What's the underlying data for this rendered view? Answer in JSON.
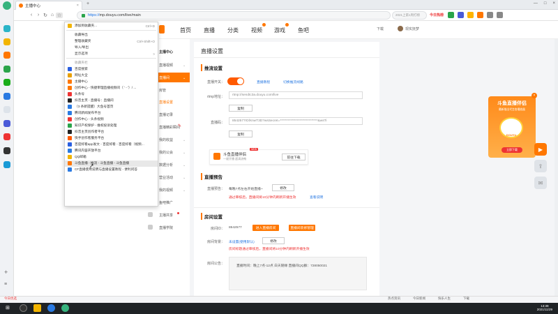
{
  "browser": {
    "tab_title": "主播中心",
    "tab_close": "×",
    "new_tab": "+",
    "url_scheme": "https://",
    "url": "mp.douyu.com/live/main",
    "search_placeholder": "2021上第1周打榜",
    "hot_label": "今日热榜",
    "window_controls": [
      "—",
      "□",
      "×"
    ]
  },
  "bookmark_menu": {
    "items": [
      {
        "label": "添加到收藏夹...",
        "shortcut": "Ctrl+D",
        "icon_color": "#f2b400"
      },
      {
        "label": "收藏导出",
        "shortcut": "",
        "icon_color": ""
      },
      {
        "label": "整理收藏夹",
        "shortcut": "Ctrl+Shift+O",
        "icon_color": ""
      },
      {
        "label": "导入/导出",
        "shortcut": "",
        "icon_color": ""
      },
      {
        "label": "显示选项",
        "shortcut": ">",
        "icon_color": ""
      },
      {
        "label": "收藏夹栏",
        "shortcut": "",
        "icon_color": "",
        "head": true
      },
      {
        "label": "百度搜索",
        "shortcut": "",
        "icon_color": "#2a5fe0"
      },
      {
        "label": "网址大全",
        "shortcut": "",
        "icon_color": "#e9a000"
      },
      {
        "label": "主播中心",
        "shortcut": "",
        "icon_color": "#ff7700"
      },
      {
        "label": "创作中心 - 快捷审理直播视频间（ ' - '）/ ...",
        "shortcut": "",
        "icon_color": "#ff7700"
      },
      {
        "label": "头条号",
        "shortcut": "",
        "icon_color": "#e33"
      },
      {
        "label": "抖音主页 - 直播号：直播间",
        "shortcut": "",
        "icon_color": "#222"
      },
      {
        "label": "（3 条新提醒）大鱼号首页",
        "shortcut": "",
        "icon_color": "#2a7ae2"
      },
      {
        "label": "腾讯新闻发布平台",
        "shortcut": "",
        "icon_color": "#2a7ae2"
      },
      {
        "label": "创作中心 - 头条视频",
        "shortcut": "",
        "icon_color": "#e33"
      },
      {
        "label": "知识产权保护 - 维权投诉处理",
        "shortcut": "",
        "icon_color": "#2aa44a"
      },
      {
        "label": "抖音主页创作者平台",
        "shortcut": "",
        "icon_color": "#222"
      },
      {
        "label": "快手创作者服务平台",
        "shortcut": "",
        "icon_color": "#ff5a00"
      },
      {
        "label": "百度好看app发文 - 百度好看 - 百度好看（视频...",
        "shortcut": "",
        "icon_color": "#2a5fe0"
      },
      {
        "label": "腾讯内容开放平台",
        "shortcut": "",
        "icon_color": "#2a7ae2"
      },
      {
        "label": "QQ邮箱",
        "shortcut": "",
        "icon_color": "#f2b400"
      },
      {
        "label": "斗鱼直播 - 推流 - 斗鱼直播 - 斗鱼直播",
        "shortcut": "",
        "icon_color": "#ff7700",
        "hl": true
      },
      {
        "label": "CF直播使用说明与直播设置教程 - 便利问答",
        "shortcut": "",
        "icon_color": "#2a7ae2"
      }
    ]
  },
  "site_nav": {
    "items": [
      "首页",
      "直播",
      "分类",
      "视频",
      "游戏",
      "鱼吧"
    ],
    "download": "下载",
    "user_name": "现实抚梦"
  },
  "sidebar": {
    "items": [
      {
        "label": "主播中心",
        "state": ""
      },
      {
        "label": "直播视频",
        "state": ""
      },
      {
        "label": "直播间",
        "state": "active"
      },
      {
        "label": "房管",
        "state": ""
      },
      {
        "label": "直播设置",
        "state": "active2"
      },
      {
        "label": "直播记录",
        "state": ""
      },
      {
        "label": "直播精彩瞬间",
        "state": ""
      },
      {
        "label": "我的收益",
        "state": ""
      },
      {
        "label": "我的公会",
        "state": ""
      },
      {
        "label": "数据分析",
        "state": ""
      },
      {
        "label": "营业活动",
        "state": ""
      },
      {
        "label": "我的视频",
        "state": ""
      },
      {
        "label": "鱼吧推广",
        "state": ""
      },
      {
        "label": "主播共享",
        "state": ""
      },
      {
        "label": "直播学院",
        "state": ""
      }
    ]
  },
  "page": {
    "title": "直播设置",
    "stream_section": "推流设置",
    "switch_label": "直播开关：",
    "link_tutorial": "直播教程",
    "link_change": "切换推流线路",
    "rtmp_label": "rtmp地址：",
    "rtmp_value": "rtmp://sendtc3a.douyu.com/live",
    "copy1": "复制",
    "code_label": "直播码：",
    "code_value": "8542577rDlXnwT3D?wsSecret=*****************************&wsTi",
    "copy2": "复制",
    "assistant_name": "斗鱼直播伴侣",
    "assistant_desc": "一键开播 超清流畅",
    "assistant_badge": "NEW",
    "assistant_btn": "前往下载",
    "preview_section": "直播预告",
    "preview_label": "直播预告：",
    "preview_value": "每晚7点左右开始直播~",
    "preview_edit": "修改",
    "preview_warn": "通过审核后，直播间将10分钟内刷新开播生效",
    "preview_link": "查看说明",
    "room_section": "房间设置",
    "room_label": "房间ID：",
    "room_id": "8542577",
    "room_btn1": "进入直播房间",
    "room_btn2": "直播间装修管理",
    "bg_label": "房间背景：",
    "bg_value": "未设置(使用默认)",
    "bg_edit": "修改",
    "bg_warn": "房间标题通过审核后，直播间将10分钟内刷新开播生效",
    "notice_label": "房间公告：",
    "notice_value": "直播时间：晚上7点-12点 白天随缘 直播间QQ群：728050021"
  },
  "ad": {
    "title": "斗鱼直播伴侣",
    "subtitle": "最新推出代言各播放器",
    "brand": "DOUYU",
    "button": "立即下载",
    "close": "×"
  },
  "statusbar": {
    "left": "今日优选",
    "right": [
      "热点资讯",
      "今日新闻",
      "快乐人生",
      "下载"
    ]
  },
  "taskbar": {
    "time": "13:39",
    "date": "2021/11/29"
  }
}
